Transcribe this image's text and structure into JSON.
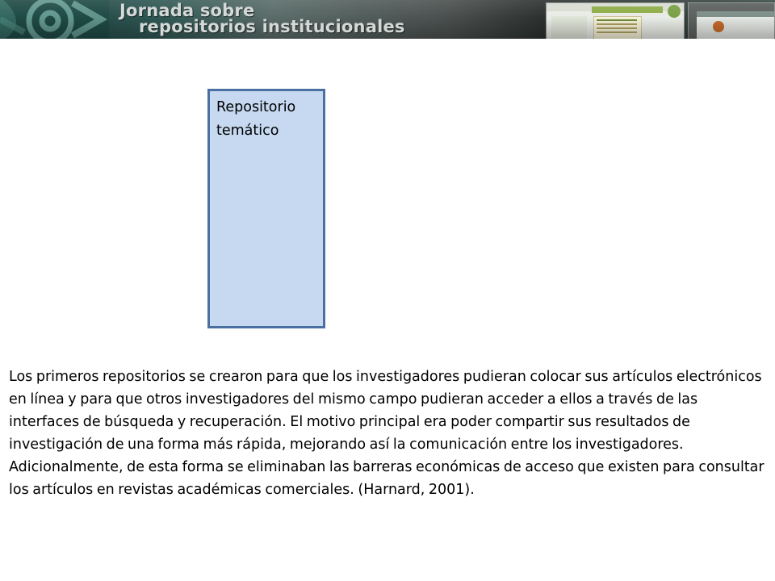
{
  "header": {
    "line1": "Jornada sobre",
    "line2": "repositorios institucionales",
    "logo_icon": "at-sign-logo-icon"
  },
  "box": {
    "label": "Repositorio temático"
  },
  "main": {
    "paragraph": "Los primeros repositorios se crearon para que los investigadores pudieran colocar sus artículos electrónicos en línea y para que otros investigadores del mismo campo pudieran acceder a ellos a través de las interfaces de búsqueda y recuperación. El motivo principal era poder compartir sus resultados de investigación de una forma más rápida, mejorando así la comunicación entre los investigadores. Adicionalmente, de esta forma se eliminaban las barreras económicas de acceso que existen para consultar los artículos en revistas académicas comerciales. (Harnard, 2001)."
  },
  "colors": {
    "box_fill": "#c6d9f1",
    "box_border": "#4a6fa0",
    "banner_dark": "#1b3a38"
  }
}
